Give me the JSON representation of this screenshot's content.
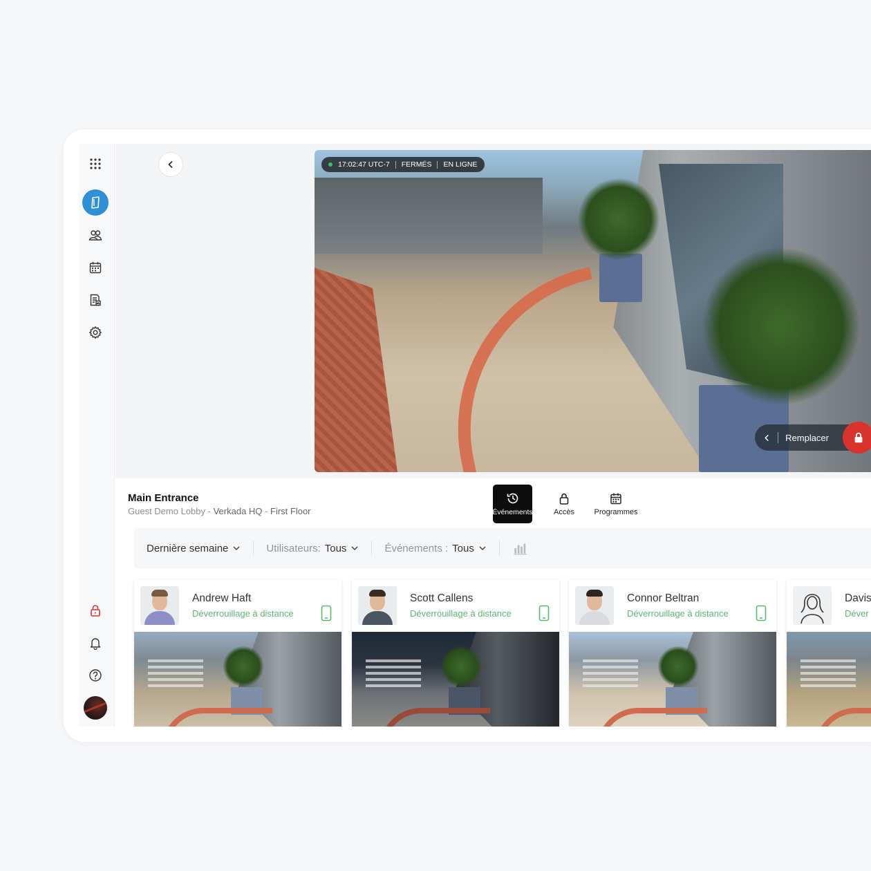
{
  "video": {
    "time": "17:02:47 UTC-7",
    "state": "FERMÉS",
    "connection": "EN LIGNE",
    "replace_label": "Remplacer"
  },
  "door": {
    "title": "Main Entrance",
    "location": "Guest Demo Lobby",
    "site": "Verkada HQ",
    "floor": "First Floor"
  },
  "tabs": [
    {
      "label": "Événements",
      "icon": "history-icon",
      "active": true
    },
    {
      "label": "Accès",
      "icon": "lock-icon",
      "active": false
    },
    {
      "label": "Programmes",
      "icon": "calendar-icon",
      "active": false
    }
  ],
  "filters": {
    "period": "Dernière semaine",
    "users_label": "Utilisateurs:",
    "users_value": "Tous",
    "events_label": "Événements :",
    "events_value": "Tous"
  },
  "events": [
    {
      "name": "Andrew Haft",
      "action": "Déverrouillage à distance"
    },
    {
      "name": "Scott Callens",
      "action": "Déverrouillage à distance"
    },
    {
      "name": "Connor Beltran",
      "action": "Déverrouillage à distance"
    },
    {
      "name": "Davis",
      "action": "Déver"
    }
  ],
  "colors": {
    "accent": "#2f8fd6",
    "success": "#5ab86a",
    "danger": "#d9332e"
  }
}
